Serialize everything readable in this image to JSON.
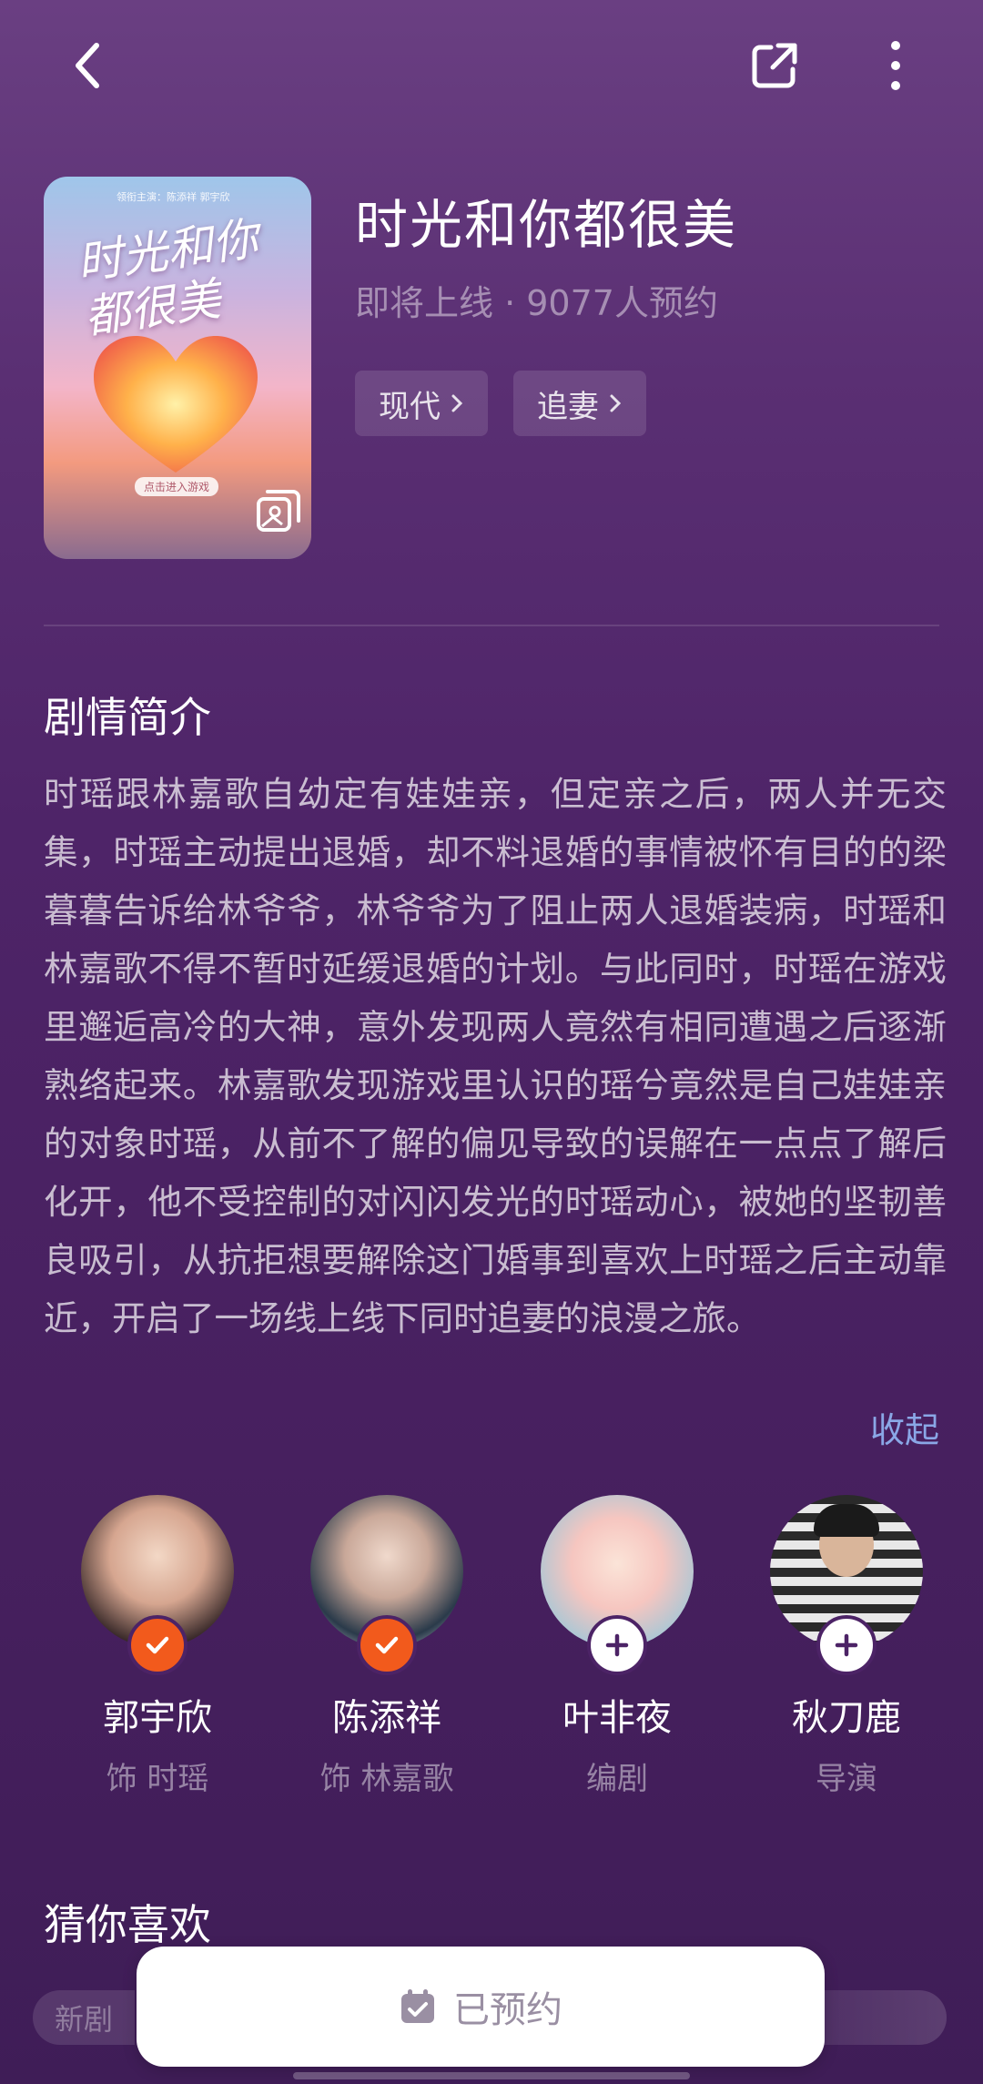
{
  "header": {
    "title": "时光和你都很美",
    "meta": "即将上线 · 9077人预约",
    "tags": [
      {
        "label": "现代"
      },
      {
        "label": "追妻"
      }
    ]
  },
  "poster": {
    "art_title": "时光和你 都很美",
    "credit": "领衔主演：陈添祥  郭宇欣",
    "cta": "点击进入游戏"
  },
  "synopsis": {
    "title": "剧情简介",
    "text": "时瑶跟林嘉歌自幼定有娃娃亲，但定亲之后，两人并无交集，时瑶主动提出退婚，却不料退婚的事情被怀有目的的梁暮暮告诉给林爷爷，林爷爷为了阻止两人退婚装病，时瑶和林嘉歌不得不暂时延缓退婚的计划。与此同时，时瑶在游戏里邂逅高冷的大神，意外发现两人竟然有相同遭遇之后逐渐熟络起来。林嘉歌发现游戏里认识的瑶兮竟然是自己娃娃亲的对象时瑶，从前不了解的偏见导致的误解在一点点了解后化开，他不受控制的对闪闪发光的时瑶动心，被她的坚韧善良吸引，从抗拒想要解除这门婚事到喜欢上时瑶之后主动靠近，开启了一场线上线下同时追妻的浪漫之旅。",
    "collapse_label": "收起"
  },
  "cast": [
    {
      "name": "郭宇欣",
      "role": "饰 时瑶",
      "status": "followed"
    },
    {
      "name": "陈添祥",
      "role": "饰 林嘉歌",
      "status": "followed"
    },
    {
      "name": "叶非夜",
      "role": "编剧",
      "status": "add"
    },
    {
      "name": "秋刀鹿",
      "role": "导演",
      "status": "add"
    }
  ],
  "guess": {
    "title": "猜你喜欢",
    "peek_tag": "新剧"
  },
  "bottom": {
    "reserve_label": "已预约",
    "reserve_icon": "calendar-check-icon"
  },
  "colors": {
    "accent_orange": "#f25a1c",
    "link_blue": "#8aa7e6",
    "bg_purple": "#4e2468"
  }
}
